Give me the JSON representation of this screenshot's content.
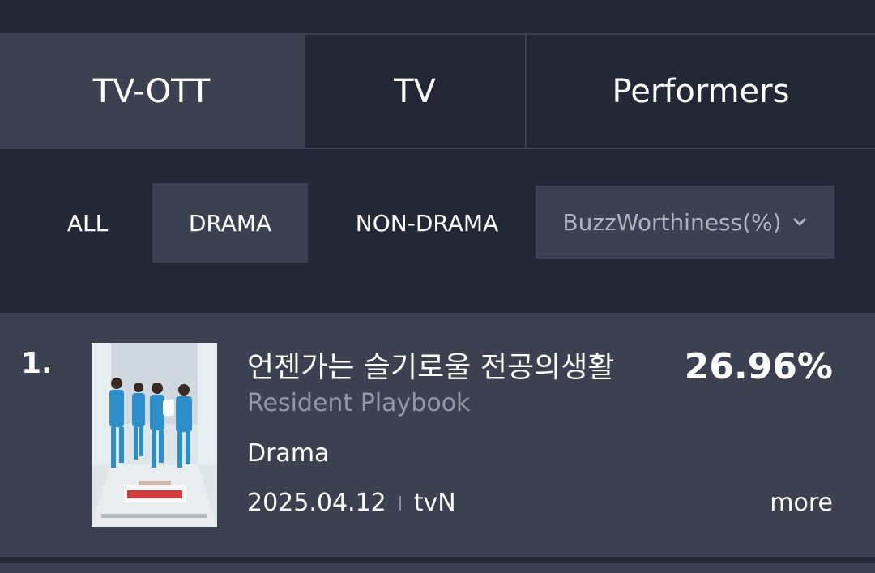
{
  "tabs": [
    {
      "label": "TV-OTT",
      "active": true
    },
    {
      "label": "TV",
      "active": false
    },
    {
      "label": "Performers",
      "active": false
    }
  ],
  "filters": {
    "all": "ALL",
    "drama": "DRAMA",
    "non_drama": "NON-DRAMA",
    "active": "DRAMA"
  },
  "sort": {
    "selected": "BuzzWorthiness(%)",
    "icon": "chevron-down-icon"
  },
  "list": [
    {
      "rank": "1.",
      "title_ko": "언젠가는 슬기로울 전공의생활",
      "title_en": "Resident Playbook",
      "genre": "Drama",
      "date": "2025.04.12",
      "channel": "tvN",
      "score": "26.96%",
      "more": "more"
    }
  ],
  "colors": {
    "background": "#222836",
    "active_tab": "#3b4150",
    "muted_text": "#9197a3"
  }
}
